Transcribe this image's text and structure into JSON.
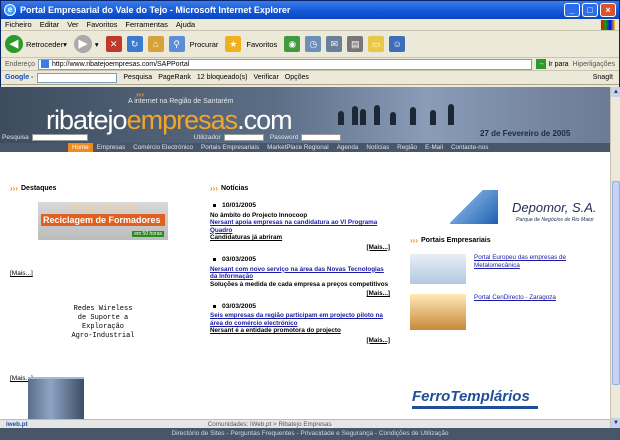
{
  "window": {
    "title": "Portal Empresarial do Vale do Tejo - Microsoft Internet Explorer"
  },
  "menu": [
    "Ficheiro",
    "Editar",
    "Ver",
    "Favoritos",
    "Ferramentas",
    "Ajuda"
  ],
  "toolbar": {
    "back": "Retroceder",
    "search": "Procurar",
    "favorites": "Favoritos"
  },
  "address": {
    "label": "Endereço",
    "url": "http://www.ribatejoempresas.com/SAPPortal",
    "go": "Ir para",
    "links": "Hiperligações"
  },
  "google_bar": {
    "logo": "Google -",
    "search": "Pesquisa",
    "pagerank": "PageRank",
    "blocked": "12 bloqueado(s)",
    "check": "Verificar",
    "options": "Opções",
    "snagit": "SnagIt"
  },
  "banner": {
    "arrows": "›››",
    "tagline": "A internet na Região de Santarém",
    "logo_a": "ribatejo",
    "logo_b": "empresas",
    "logo_c": ".com",
    "date": "27 de Fevereiro de 2005",
    "search_label": "Pesquisa",
    "user_label": "Utilizador",
    "password_label": "Password"
  },
  "nav": [
    "Home",
    "Empresas",
    "Comércio Electrónico",
    "Portais Empresariais",
    "MarketPlace Regional",
    "Agenda",
    "Notícias",
    "Região",
    "E-Mail",
    "Contacte-nos"
  ],
  "destaques": {
    "title": "Destaques",
    "banner_top": "Formação de Formadores",
    "banner_main": "Reciclagem de Formadores",
    "banner_tag": "em 50 horas",
    "more": "[Mais...]",
    "wireless": [
      "Redes Wireless",
      "de Suporte a",
      "Exploração",
      "Agro-Industrial"
    ],
    "more2": "[Mais...]"
  },
  "noticias": {
    "title": "Notícias",
    "items": [
      {
        "date": "10/01/2005",
        "kicker": "No âmbito do Projecto Innocoop",
        "link": "Nersant apoia empresas na candidatura ao VI Programa Quadro",
        "sub": "Candidaturas já abriram",
        "more": "[Mais...]"
      },
      {
        "date": "03/03/2005",
        "link": "Nersant com novo serviço na área das Novas Tecnologias da Informação",
        "sub": "Soluções à medida de cada empresa a preços competitivos",
        "more": "[Mais...]"
      },
      {
        "date": "03/03/2005",
        "link": "Seis empresas da região participam em projecto piloto na área do comércio electrónico",
        "sub": "Nersant é a entidade promotora do projecto",
        "more": "[Mais...]"
      }
    ]
  },
  "depomor": {
    "name": "Depomor, S.A.",
    "sub": "Parque de Negócios de Rio Maior"
  },
  "portais": {
    "title": "Portais Empresariais",
    "items": [
      {
        "text": "Portal Europeu das empresas de Metalomecânica"
      },
      {
        "text": "Portal CenDirecto - Zaragoza"
      }
    ]
  },
  "ferro": {
    "name": "FerroTemplários"
  },
  "footer": {
    "logo": "iweb.pt",
    "community": "Comunidades: iWeb.pt > Ribatejo Empresas",
    "links": "Directório de Sites - Perguntas Frequentes - Privacidade e Segurança - Condições de Utilização"
  }
}
